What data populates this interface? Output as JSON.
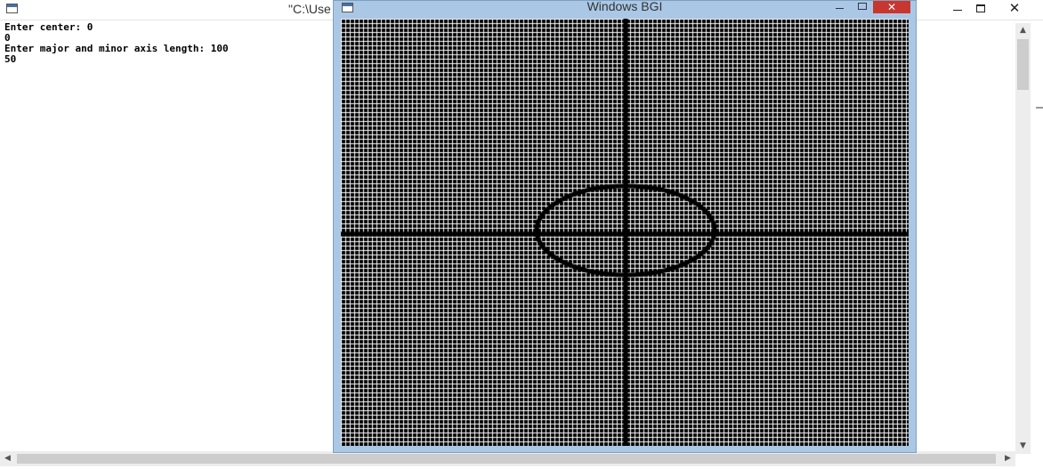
{
  "console": {
    "title": "\"C:\\Use",
    "output": "Enter center: 0\n0\nEnter major and minor axis length: 100\n50",
    "controls": {
      "minimize_icon": "minimize-icon",
      "maximize_icon": "maximize-icon",
      "close_glyph": "✕"
    }
  },
  "bgi_window": {
    "title": "Windows BGI",
    "close_glyph": "✕"
  },
  "colors": {
    "bgi_frame": "#aac8e6",
    "bgi_close": "#c7372f",
    "grid_background": "#000000",
    "grid_lines": "#ffffff",
    "axes": "#000000",
    "ellipse": "#000000"
  },
  "drawing": {
    "major_axis_length": 100,
    "minor_axis_length": 50
  }
}
